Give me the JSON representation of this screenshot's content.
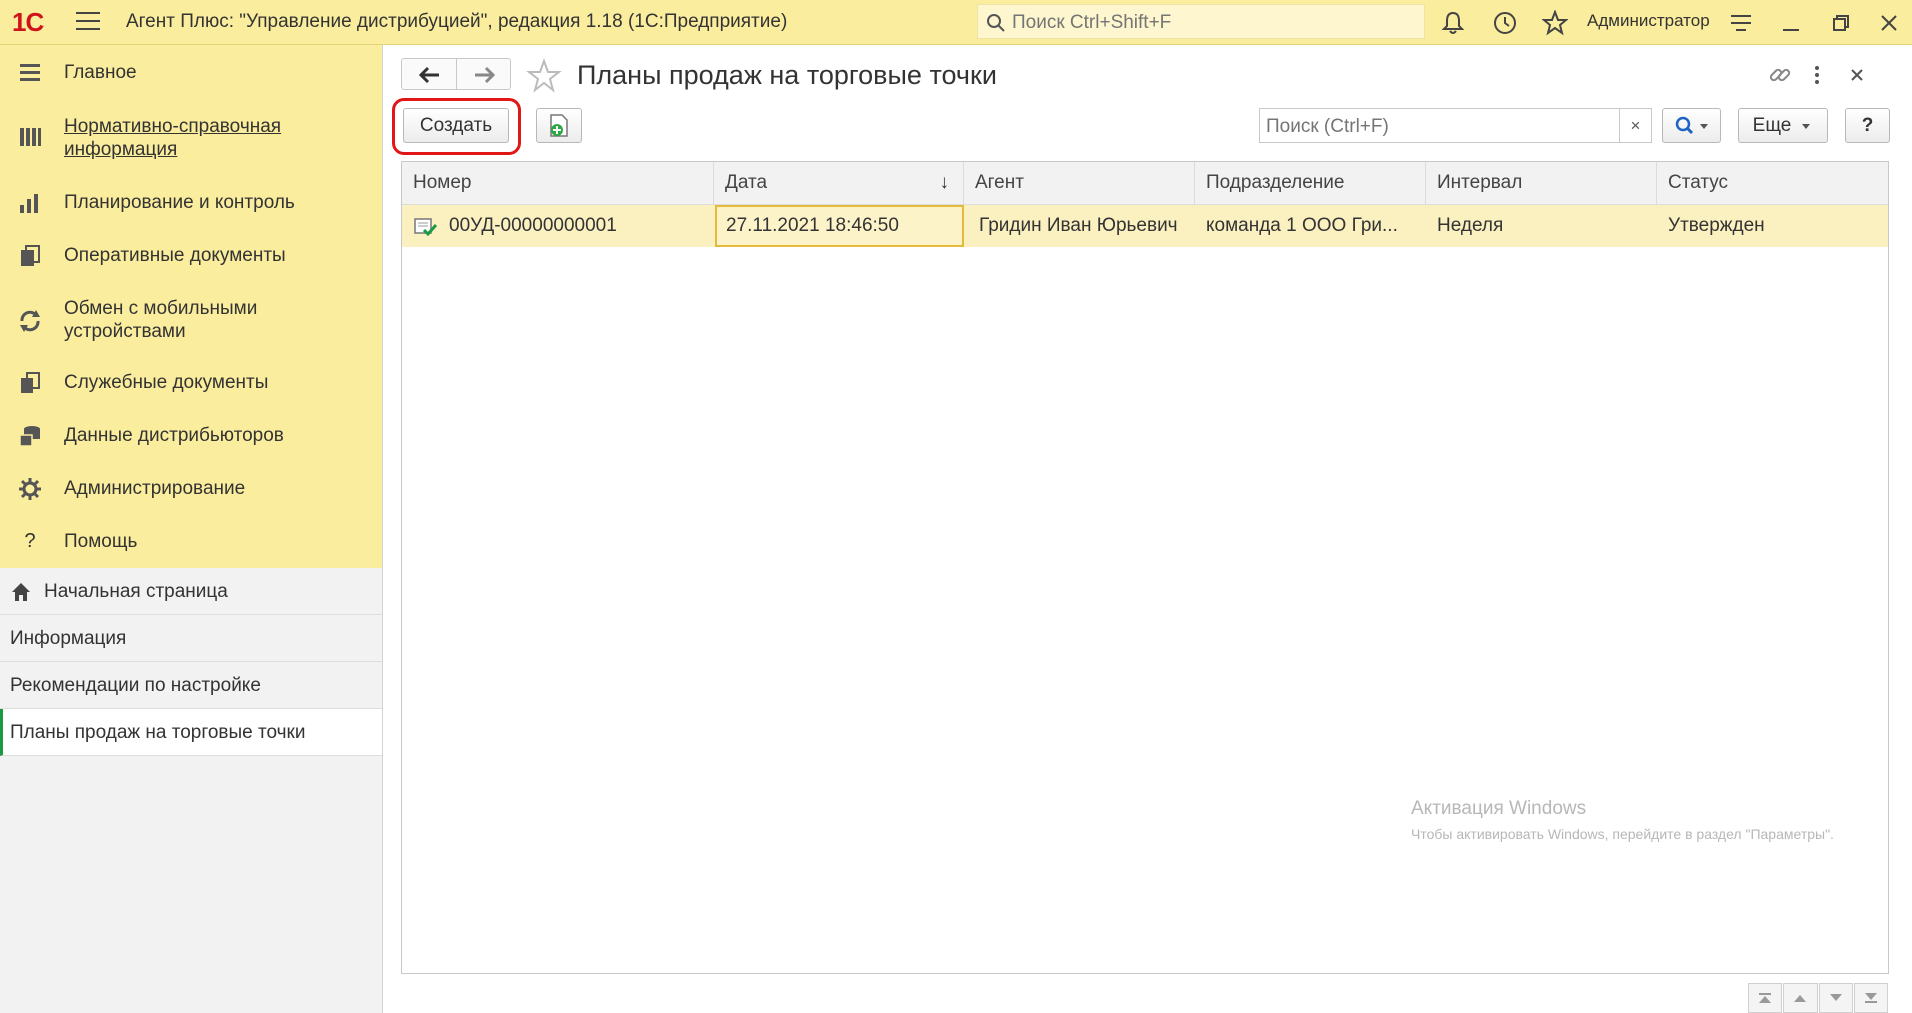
{
  "topbar": {
    "logo": "1С",
    "title": "Агент Плюс: \"Управление дистрибуцией\", редакция 1.18  (1С:Предприятие)",
    "search_placeholder": "Поиск Ctrl+Shift+F",
    "user": "Администратор"
  },
  "sidebar": {
    "sections": [
      {
        "label": "Главное",
        "icon": "list-icon"
      },
      {
        "label": "Нормативно-справочная информация",
        "icon": "reference-icon"
      },
      {
        "label": "Планирование и контроль",
        "icon": "chart-icon"
      },
      {
        "label": "Оперативные документы",
        "icon": "documents-icon"
      },
      {
        "label": "Обмен с мобильными устройствами",
        "icon": "sync-icon"
      },
      {
        "label": "Служебные документы",
        "icon": "service-docs-icon"
      },
      {
        "label": "Данные дистрибьюторов",
        "icon": "database-icon"
      },
      {
        "label": "Администрирование",
        "icon": "gear-icon"
      },
      {
        "label": "Помощь",
        "icon": "help-icon"
      }
    ],
    "open_windows": [
      {
        "label": "Начальная страница"
      },
      {
        "label": "Информация"
      },
      {
        "label": "Рекомендации по настройке"
      },
      {
        "label": "Планы продаж на торговые точки"
      }
    ]
  },
  "main": {
    "title": "Планы продаж на торговые точки",
    "create_label": "Создать",
    "search_placeholder": "Поиск (Ctrl+F)",
    "clear_label": "×",
    "more_label": "Еще",
    "help_label": "?",
    "columns": [
      "Номер",
      "Дата",
      "Агент",
      "Подразделение",
      "Интервал",
      "Статус"
    ],
    "sort_indicator": "↓",
    "rows": [
      {
        "number": "00УД-00000000001",
        "date": "27.11.2021 18:46:50",
        "agent": "Гридин Иван Юрьевич",
        "division": "команда 1 ООО Гри...",
        "interval": "Неделя",
        "status": "Утвержден"
      }
    ]
  },
  "watermark": {
    "line1": "Активация Windows",
    "line2": "Чтобы активировать Windows, перейдите в раздел \"Параметры\"."
  },
  "colors": {
    "accent_yellow": "#fbed9e",
    "row_highlight": "#fbf0c0",
    "annotation_red": "#e11717",
    "active_marker": "#1a9a43"
  }
}
